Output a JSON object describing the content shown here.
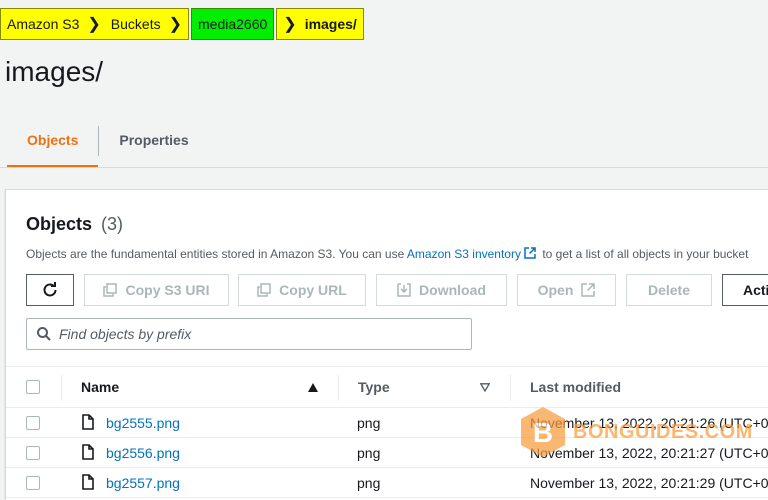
{
  "breadcrumb": {
    "items": [
      "Amazon S3",
      "Buckets",
      "media2660",
      "images/"
    ],
    "highlight_colors": {
      "yellow": "#ffff00",
      "green": "#00ee00"
    }
  },
  "page": {
    "title": "images/"
  },
  "tabs": [
    {
      "label": "Objects",
      "active": true
    },
    {
      "label": "Properties",
      "active": false
    }
  ],
  "objects_panel": {
    "heading": "Objects",
    "count": "(3)",
    "description_before": "Objects are the fundamental entities stored in Amazon S3. You can use ",
    "description_link": "Amazon S3 inventory",
    "description_after": " to get a list of all objects in your bucket"
  },
  "actions": {
    "refresh_icon": "refresh-icon",
    "copy_s3_uri": "Copy S3 URI",
    "copy_url": "Copy URL",
    "download": "Download",
    "open": "Open",
    "delete": "Delete",
    "actions": "Acti"
  },
  "search": {
    "placeholder": "Find objects by prefix"
  },
  "table": {
    "columns": [
      "Name",
      "Type",
      "Last modified"
    ],
    "rows": [
      {
        "name": "bg2555.png",
        "type": "png",
        "last_modified": "November 13, 2022, 20:21:26 (UTC+0"
      },
      {
        "name": "bg2556.png",
        "type": "png",
        "last_modified": "November 13, 2022, 20:21:27 (UTC+0"
      },
      {
        "name": "bg2557.png",
        "type": "png",
        "last_modified": "November 13, 2022, 20:21:29 (UTC+0"
      }
    ]
  },
  "watermark": {
    "text": "BONGUIDES.COM",
    "logo_letter": "B",
    "color": "#f79c3b"
  },
  "colors": {
    "accent": "#ec7211",
    "link": "#0073bb"
  }
}
